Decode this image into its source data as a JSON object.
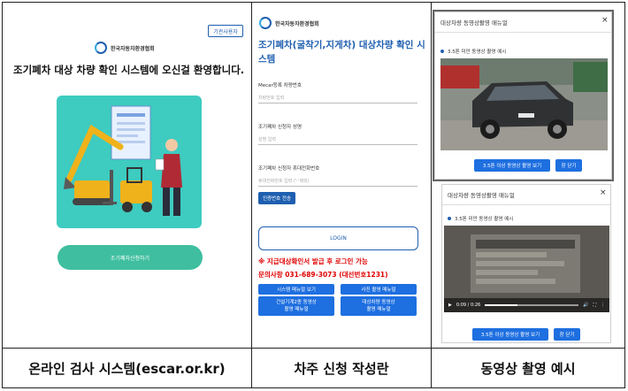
{
  "panel1": {
    "org_name": "한국자동차환경협회",
    "login_label": "기관사용자",
    "welcome": "조기폐차 대상 차량 확인 시스템에 오신걸 환영합니다.",
    "button_label": "조기폐차신청하기",
    "illustration_color": "#3ecbc0",
    "button_color": "#3fbf9f"
  },
  "panel2": {
    "org_name": "한국자동차환경협회",
    "title": "조기폐차(굴착기,지게차) 대상차량 확인 시스템",
    "fields": [
      {
        "label": "Mecar등록 차량번호",
        "placeholder": "차량번호 입력"
      },
      {
        "label": "조기폐차 신청자 성명",
        "placeholder": "성명 입력"
      },
      {
        "label": "조기폐차 신청자 휴대전화번호",
        "placeholder": "휴대전화번호 입력 ('-'제외)"
      }
    ],
    "auth_button": "인증번호 전송",
    "login_button": "LOGIN",
    "notice": "※ 지급대상확인서 발급 후 로그인 가능",
    "contact": "문의사항 031-689-3073 (대선번호1231)",
    "buttons": [
      {
        "label": "시스템 매뉴얼 보기"
      },
      {
        "label": "사진 촬영 매뉴얼"
      },
      {
        "label": "건설기계2종 동영상\n촬영 매뉴얼"
      },
      {
        "label": "대상차량 동영상\n촬영 매뉴얼"
      }
    ],
    "accent": "#1f5fb0",
    "notice_color": "#e00000"
  },
  "panel3": {
    "top_modal": {
      "title": "대상차량 동영상촬영 매뉴얼",
      "close": "×",
      "bullet": "3.5톤 미만 동영상 촬영 예시",
      "primary_button": "3.5톤 이상 동영상 촬영 보기",
      "close_button": "창 닫기"
    },
    "bottom_modal": {
      "title": "대상차량 동영상촬영 매뉴얼",
      "close": "×",
      "bullet": "3.5톤 미만 동영상 촬영 예시",
      "video_time": "0:09 / 0:26",
      "video_progress": 0.35,
      "primary_button": "3.5톤 이상 동영상 촬영 보기",
      "close_button": "창 닫기"
    }
  },
  "captions": {
    "left": "온라인 검사 시스템(escar.or.kr)",
    "middle": "차주 신청 작성란",
    "right": "동영상 촬영 예시"
  }
}
